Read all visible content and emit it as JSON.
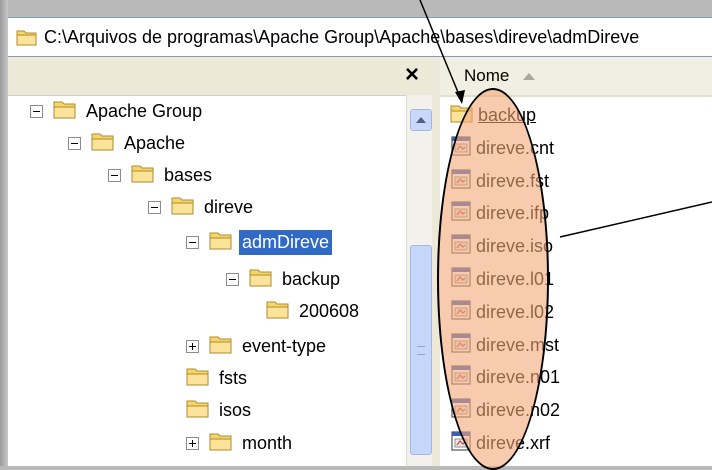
{
  "address": {
    "path": "C:\\Arquivos de programas\\Apache Group\\Apache\\bases\\direve\\admDireve"
  },
  "folders_pane": {
    "close_label": "×",
    "tree": [
      {
        "label": "Apache Group",
        "expander": "minus"
      },
      {
        "label": "Apache",
        "expander": "minus"
      },
      {
        "label": "bases",
        "expander": "minus"
      },
      {
        "label": "direve",
        "expander": "minus"
      },
      {
        "label": "admDireve",
        "expander": "minus",
        "selected": true
      },
      {
        "label": "backup",
        "expander": "minus"
      },
      {
        "label": "200608",
        "expander": "none"
      },
      {
        "label": "event-type",
        "expander": "plus"
      },
      {
        "label": "fsts",
        "expander": "none"
      },
      {
        "label": "isos",
        "expander": "none"
      },
      {
        "label": "month",
        "expander": "plus"
      }
    ]
  },
  "files_pane": {
    "column_header": "Nome",
    "files": [
      {
        "name": "backup",
        "icon": "folder-icon"
      },
      {
        "name": "direve.cnt",
        "icon": "file-icon"
      },
      {
        "name": "direve.fst",
        "icon": "file-icon"
      },
      {
        "name": "direve.ifp",
        "icon": "file-icon"
      },
      {
        "name": "direve.iso",
        "icon": "file-icon"
      },
      {
        "name": "direve.l01",
        "icon": "file-icon"
      },
      {
        "name": "direve.l02",
        "icon": "file-icon"
      },
      {
        "name": "direve.mst",
        "icon": "file-icon"
      },
      {
        "name": "direve.n01",
        "icon": "file-icon"
      },
      {
        "name": "direve.n02",
        "icon": "file-icon"
      },
      {
        "name": "direve.xrf",
        "icon": "file-icon"
      }
    ]
  },
  "colors": {
    "selection": "#316ac5",
    "highlight_ellipse": "#f4a678",
    "folder_yellow": "#f5d66b"
  }
}
